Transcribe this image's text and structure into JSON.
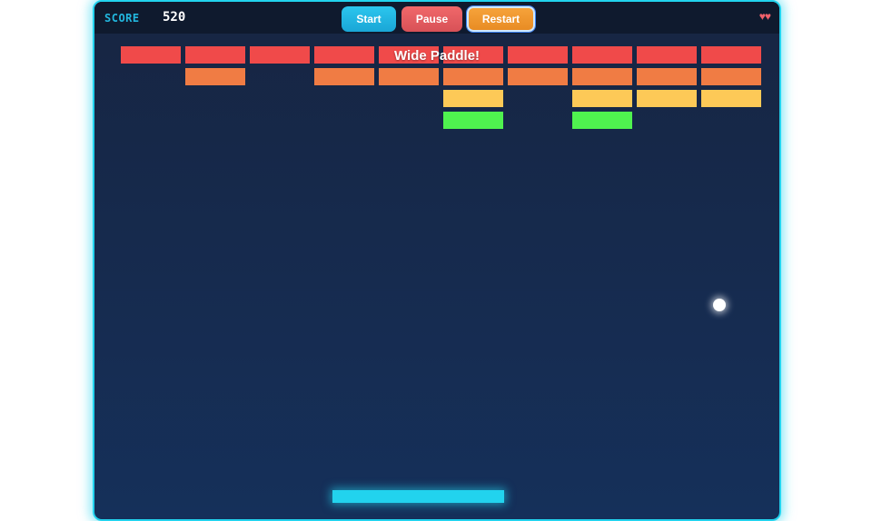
{
  "hud": {
    "score_label": "SCORE",
    "score_value": "520",
    "lives_display": "♥♥",
    "lives_count": 2
  },
  "controls": {
    "start_label": "Start",
    "pause_label": "Pause",
    "restart_label": "Restart"
  },
  "powerup_message": "Wide Paddle!",
  "colors": {
    "accent": "#22d3ee",
    "brick_red": "#f04a4a",
    "brick_orange": "#f07c44",
    "brick_yellow": "#fdc957",
    "brick_green": "#4ff24f",
    "background": "#172542"
  },
  "bricks": {
    "columns": 10,
    "rows": [
      {
        "color": "brick_red",
        "present": [
          1,
          1,
          1,
          1,
          1,
          1,
          1,
          1,
          1,
          1
        ]
      },
      {
        "color": "brick_orange",
        "present": [
          0,
          1,
          0,
          1,
          1,
          1,
          1,
          1,
          1,
          1
        ]
      },
      {
        "color": "brick_yellow",
        "present": [
          0,
          0,
          0,
          0,
          0,
          1,
          0,
          1,
          1,
          1
        ]
      },
      {
        "color": "brick_green",
        "present": [
          0,
          0,
          0,
          0,
          0,
          1,
          0,
          1,
          0,
          0
        ]
      }
    ]
  }
}
